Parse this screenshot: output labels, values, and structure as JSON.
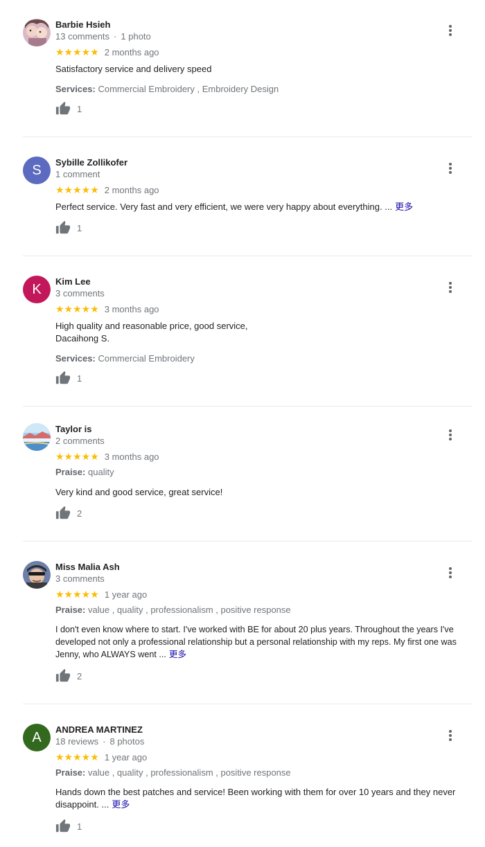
{
  "reviews": [
    {
      "name": "Barbie Hsieh",
      "comments": "13 comments",
      "photos": "1 photo",
      "stars": "★★★★★",
      "ago": "2 months ago",
      "text": "Satisfactory service and delivery speed",
      "attr_label": "Services:",
      "attr_value": "Commercial Embroidery ,  Embroidery Design",
      "likes": "1",
      "avatar_icon": "photo-avatar"
    },
    {
      "name": "Sybille Zollikofer",
      "comments": "1 comment",
      "stars": "★★★★★",
      "ago": "2 months ago",
      "text": "Perfect service. Very fast and very efficient, we were very happy about everything. ...",
      "more": "更多",
      "likes": "1",
      "avatar_letter": "S",
      "avatar_color": "#5c6bc0"
    },
    {
      "name": "Kim Lee",
      "comments": "3 comments",
      "stars": "★★★★★",
      "ago": "3 months ago",
      "text_line1": "High quality and reasonable price, good service,",
      "text_line2": "Dacaihong S.",
      "attr_label": "Services:",
      "attr_value": "Commercial Embroidery",
      "likes": "1",
      "avatar_letter": "K",
      "avatar_color": "#c2185b"
    },
    {
      "name": "Taylor is",
      "comments": "2 comments",
      "stars": "★★★★★",
      "ago": "3 months ago",
      "attr_label": "Praise:",
      "attr_value": "quality",
      "text": "Very kind and good service, great service!",
      "likes": "2",
      "avatar_icon": "landscape-avatar"
    },
    {
      "name": "Miss Malia Ash",
      "comments": "3 comments",
      "stars": "★★★★★",
      "ago": "1 year ago",
      "attr_label": "Praise:",
      "attr_value": "value , quality , professionalism , positive response",
      "text_line1": "I don't even know where to start.  I've worked with BE for about 20 plus years.  Throughout the years I've",
      "text_line2": "developed not only a professional relationship but a personal relationship with my reps.  My first one was",
      "text_line3": "Jenny, who ALWAYS went ...",
      "more": "更多",
      "likes": "2",
      "avatar_icon": "photo-avatar"
    },
    {
      "name": "ANDREA MARTINEZ",
      "comments": "18 reviews",
      "photos": "8 photos",
      "stars": "★★★★★",
      "ago": "1 year ago",
      "attr_label": "Praise:",
      "attr_value": "value , quality , professionalism , positive response",
      "text_line1": "Hands down the best patches and service! Been working with them for over 10 years and they never",
      "text_line2": "disappoint. ...",
      "more": "更多",
      "likes": "1",
      "avatar_letter": "A",
      "avatar_color": "#33691e"
    }
  ]
}
